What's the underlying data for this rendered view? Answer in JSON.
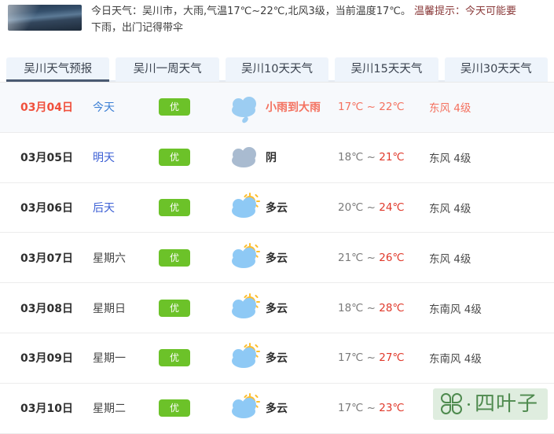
{
  "summary": {
    "line1": "今日天气：吴川市，大雨,气温17℃~22℃,北风3级，当前温度17℃。",
    "tip": "温馨提示：今天可能要",
    "line2": "下雨，出门记得带伞",
    "thumb_alt": "天气实景图"
  },
  "tabs": [
    {
      "label": "吴川天气预报",
      "active": true
    },
    {
      "label": "吴川一周天气",
      "active": false
    },
    {
      "label": "吴川10天天气",
      "active": false
    },
    {
      "label": "吴川15天天气",
      "active": false
    },
    {
      "label": "吴川30天天气",
      "active": false
    }
  ],
  "forecast": {
    "rows": [
      {
        "date": "03月04日",
        "day": "今天",
        "aqi": "优",
        "icon": "rain",
        "condition": "小雨到大雨",
        "temp_low": "17℃",
        "temp_sep": " ~ ",
        "temp_high": "22℃",
        "wind": "东风 4级",
        "today": true,
        "day_link": true
      },
      {
        "date": "03月05日",
        "day": "明天",
        "aqi": "优",
        "icon": "overcast",
        "condition": "阴",
        "temp_low": "18℃",
        "temp_sep": " ~ ",
        "temp_high": "21℃",
        "wind": "东风 4级",
        "today": false,
        "day_link": true
      },
      {
        "date": "03月06日",
        "day": "后天",
        "aqi": "优",
        "icon": "partly",
        "condition": "多云",
        "temp_low": "20℃",
        "temp_sep": " ~ ",
        "temp_high": "24℃",
        "wind": "东风 4级",
        "today": false,
        "day_link": true
      },
      {
        "date": "03月07日",
        "day": "星期六",
        "aqi": "优",
        "icon": "partly",
        "condition": "多云",
        "temp_low": "21℃",
        "temp_sep": " ~ ",
        "temp_high": "26℃",
        "wind": "东风 4级",
        "today": false,
        "day_link": false
      },
      {
        "date": "03月08日",
        "day": "星期日",
        "aqi": "优",
        "icon": "partly",
        "condition": "多云",
        "temp_low": "18℃",
        "temp_sep": " ~ ",
        "temp_high": "28℃",
        "wind": "东南风 4级",
        "today": false,
        "day_link": false
      },
      {
        "date": "03月09日",
        "day": "星期一",
        "aqi": "优",
        "icon": "partly",
        "condition": "多云",
        "temp_low": "17℃",
        "temp_sep": " ~ ",
        "temp_high": "27℃",
        "wind": "东南风 4级",
        "today": false,
        "day_link": false
      },
      {
        "date": "03月10日",
        "day": "星期二",
        "aqi": "优",
        "icon": "partly",
        "condition": "多云",
        "temp_low": "17℃",
        "temp_sep": " ~ ",
        "temp_high": "23℃",
        "wind": "",
        "today": false,
        "day_link": false
      }
    ]
  },
  "watermark": {
    "text": "四叶子",
    "logo": "clover-icon"
  },
  "colors": {
    "accent_blue": "#3b5fd4",
    "today_red": "#f4715f",
    "high_temp_red": "#e0392b",
    "aqi_green": "#6cc229",
    "tab_bg": "#eef4fb",
    "watermark_green": "#4e8a4e"
  }
}
